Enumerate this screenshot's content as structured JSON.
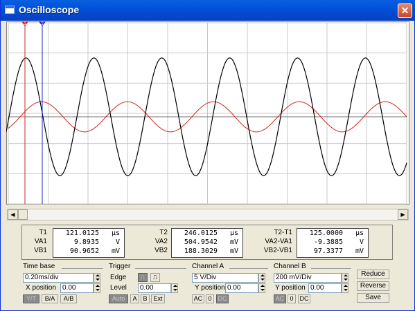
{
  "window": {
    "title": "Oscilloscope",
    "close": "✕"
  },
  "cursors": [
    {
      "label": "1",
      "color": "#d02020"
    },
    {
      "label": "2",
      "color": "#2020d0"
    }
  ],
  "screen": {
    "grid": {
      "cols": 10,
      "rows": 6
    },
    "traces": [
      {
        "name": "Channel A",
        "color": "#000000",
        "amplitude_div": 1.95
      },
      {
        "name": "Channel B",
        "color": "#d02020",
        "amplitude_div": 0.5
      }
    ]
  },
  "readout": {
    "t1": {
      "T1": "121.0125",
      "T1_unit": "µs",
      "VA1": "9.8935",
      "VA1_unit": "V",
      "VB1": "90.9652",
      "VB1_unit": "mV"
    },
    "t2": {
      "T2": "246.0125",
      "T2_unit": "µs",
      "VA2": "504.9542",
      "VA2_unit": "mV",
      "VB2": "188.3029",
      "VB2_unit": "mV"
    },
    "diff": {
      "T2-T1": "125.0000",
      "T_unit": "µs",
      "VA2-VA1": "-9.3885",
      "VA_unit": "V",
      "VB2-VB1": "97.3377",
      "VB_unit": "mV"
    },
    "labels": {
      "T1": "T1",
      "VA1": "VA1",
      "VB1": "VB1",
      "T2": "T2",
      "VA2": "VA2",
      "VB2": "VB2",
      "T21": "T2-T1",
      "VA21": "VA2-VA1",
      "VB21": "VB2-VB1"
    }
  },
  "timebase": {
    "title": "Time base",
    "value": "0.20ms/div",
    "xpos_label": "X position",
    "xpos": "0.00",
    "buttons": [
      "Y/T",
      "B/A",
      "A/B"
    ]
  },
  "trigger": {
    "title": "Trigger",
    "edge_label": "Edge",
    "level_label": "Level",
    "level": "0.00",
    "buttons": [
      "Auto",
      "A",
      "B",
      "Ext"
    ]
  },
  "channel_a": {
    "title": "Channel A",
    "value": "5 V/Div",
    "ypos_label": "Y position",
    "ypos": "0.00",
    "buttons": [
      "AC",
      "0",
      "DC"
    ]
  },
  "channel_b": {
    "title": "Channel B",
    "value": "200 mV/Div",
    "ypos_label": "Y position",
    "ypos": "0.00",
    "buttons": [
      "AC",
      "0",
      "DC"
    ]
  },
  "actions": {
    "reduce": "Reduce",
    "reverse": "Reverse",
    "save": "Save"
  }
}
